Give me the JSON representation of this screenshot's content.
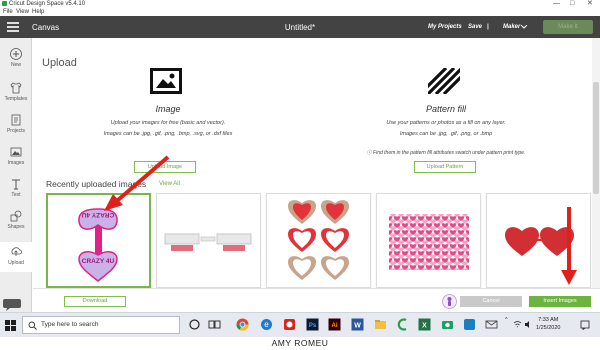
{
  "window": {
    "title": "Cricut Design Space  v5.4.10",
    "controls": [
      "—",
      "□",
      "✕"
    ]
  },
  "menu": [
    "File",
    "View",
    "Help"
  ],
  "header": {
    "canvas_label": "Canvas",
    "document_title": "Untitled*",
    "my_projects": "My Projects",
    "save": "Save",
    "separator": "|",
    "machine": "Maker",
    "make_it": "Make It"
  },
  "sidebar": [
    {
      "label": "New",
      "icon": "plus-icon"
    },
    {
      "label": "Templates",
      "icon": "shirt-icon"
    },
    {
      "label": "Projects",
      "icon": "projects-icon"
    },
    {
      "label": "Images",
      "icon": "image-icon"
    },
    {
      "label": "Text",
      "icon": "text-icon"
    },
    {
      "label": "Shapes",
      "icon": "shapes-icon"
    },
    {
      "label": "Upload",
      "icon": "upload-icon"
    }
  ],
  "upload": {
    "title": "Upload",
    "image": {
      "title": "Image",
      "line1": "Upload your images for free (basic and vector).",
      "line2": "Images can be .jpg, .gif, .png, .bmp, .svg, or .dxf files",
      "button": "Upload Image"
    },
    "pattern": {
      "title": "Pattern fill",
      "line1": "Use your patterns or photos as a fill on any layer.",
      "line2": "Images can be .jpg, .gif, .png, or .bmp",
      "line3": "ⓘ Find them in the pattern fill attributes swatch under pattern print type.",
      "button": "Upload Pattern"
    },
    "recent_title": "Recently uploaded images",
    "view_all": "View All",
    "thumbnails": [
      {
        "name": "conversation-hearts",
        "texts": [
          "CRAZY 4U",
          "CRAZY 4U"
        ]
      },
      {
        "name": "glasses-tags"
      },
      {
        "name": "heart-pairs"
      },
      {
        "name": "heart-pattern"
      },
      {
        "name": "red-hearts"
      }
    ]
  },
  "actions": {
    "download": "Download",
    "cancel": "Cancel",
    "insert": "Insert Images"
  },
  "taskbar": {
    "search_placeholder": "Type here to search",
    "time": "7:33 AM",
    "date": "1/25/2020"
  },
  "watermark": "AMY ROMEU",
  "colors": {
    "header": "#434343",
    "accent_green": "#6db33f",
    "annotation_red": "#e0211b",
    "heart_red": "#d22f35"
  }
}
